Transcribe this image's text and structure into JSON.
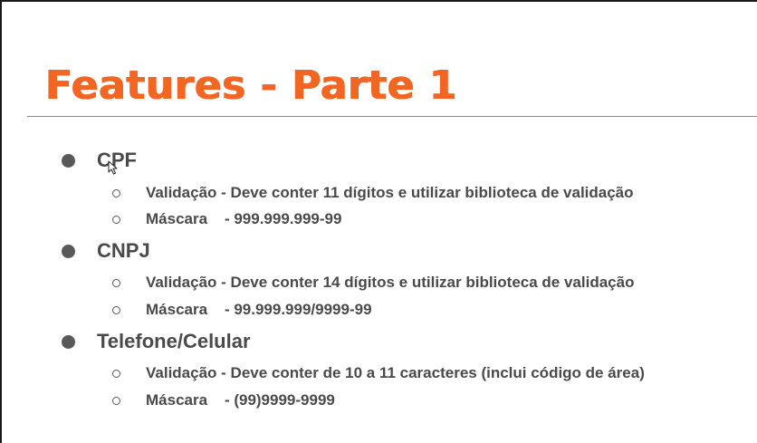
{
  "slide": {
    "title": "Features - Parte 1",
    "sections": [
      {
        "label": "CPF",
        "items": [
          "Validação - Deve conter 11 dígitos e utilizar biblioteca de validação",
          "Máscara    - 999.999.999-99"
        ]
      },
      {
        "label": "CNPJ",
        "items": [
          "Validação - Deve conter 14 dígitos e utilizar biblioteca de validação",
          "Máscara    - 99.999.999/9999-99"
        ]
      },
      {
        "label": "Telefone/Celular",
        "items": [
          "Validação - Deve conter de 10 a 11 caracteres (inclui código de área)",
          "Máscara    - (99)9999-9999"
        ]
      }
    ]
  },
  "colors": {
    "title": "#f26522",
    "text": "#4a4a4a",
    "bullet": "#595959",
    "divider": "#8a8a8a"
  },
  "icons": {
    "cursor": "mouse-pointer-icon"
  }
}
